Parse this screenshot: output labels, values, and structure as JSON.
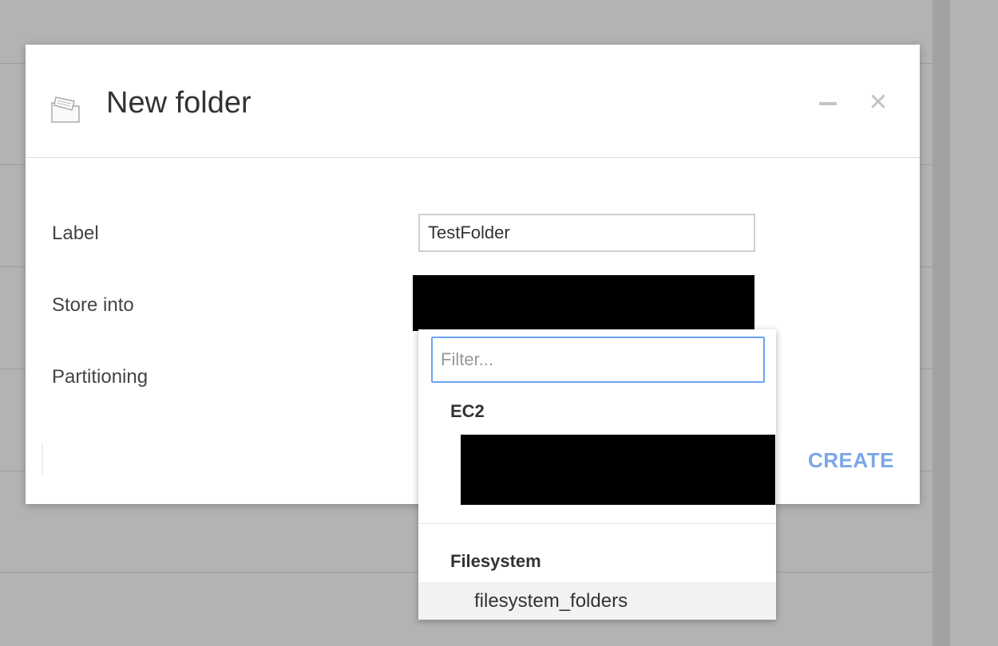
{
  "dialog": {
    "title": "New folder",
    "icon": "folder-icon",
    "minimize_icon": "minimize-icon",
    "close_icon": "close-icon",
    "close_glyph": "✕"
  },
  "form": {
    "label_field": {
      "label": "Label",
      "value": "TestFolder"
    },
    "store_into": {
      "label": "Store into",
      "value": ""
    },
    "partitioning": {
      "label": "Partitioning"
    }
  },
  "dropdown": {
    "filter_placeholder": "Filter...",
    "groups": [
      {
        "name": "EC2",
        "items": [
          ""
        ]
      },
      {
        "name": "Filesystem",
        "items": [
          "filesystem_folders"
        ]
      }
    ]
  },
  "actions": {
    "create_label": "CREATE"
  },
  "colors": {
    "accent": "#7aa7e8",
    "focus_border": "#6aa3f0",
    "backdrop": "#b3b3b3",
    "redaction": "#000000"
  }
}
